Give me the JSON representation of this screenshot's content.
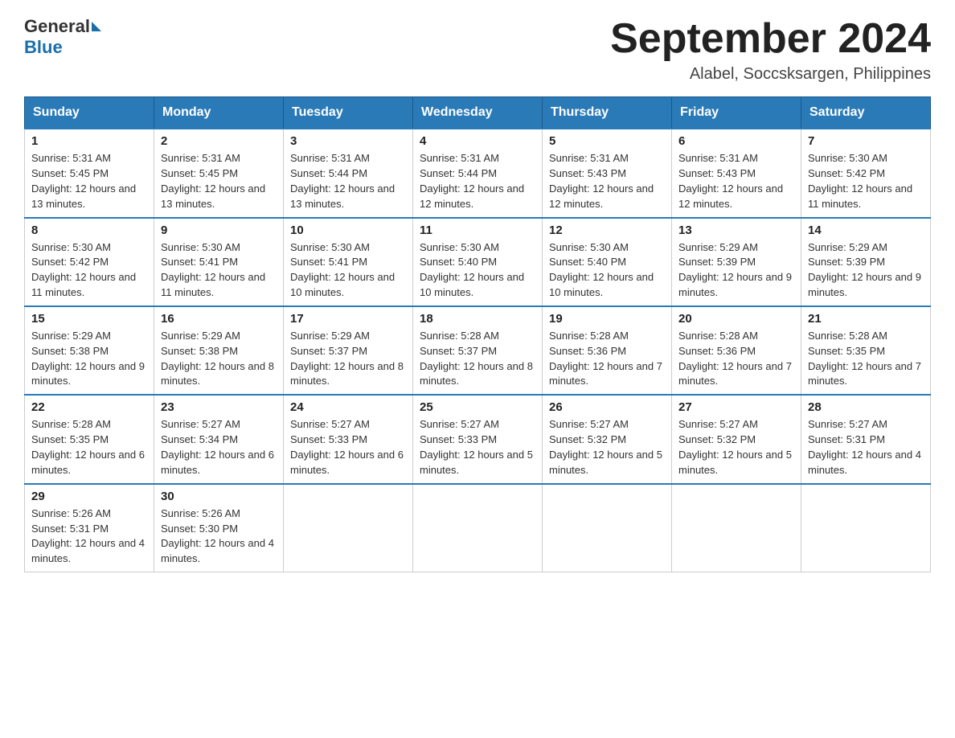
{
  "header": {
    "logo_general": "General",
    "logo_blue": "Blue",
    "month_title": "September 2024",
    "subtitle": "Alabel, Soccsksargen, Philippines"
  },
  "weekdays": [
    "Sunday",
    "Monday",
    "Tuesday",
    "Wednesday",
    "Thursday",
    "Friday",
    "Saturday"
  ],
  "weeks": [
    [
      {
        "day": "1",
        "sunrise": "5:31 AM",
        "sunset": "5:45 PM",
        "daylight": "12 hours and 13 minutes."
      },
      {
        "day": "2",
        "sunrise": "5:31 AM",
        "sunset": "5:45 PM",
        "daylight": "12 hours and 13 minutes."
      },
      {
        "day": "3",
        "sunrise": "5:31 AM",
        "sunset": "5:44 PM",
        "daylight": "12 hours and 13 minutes."
      },
      {
        "day": "4",
        "sunrise": "5:31 AM",
        "sunset": "5:44 PM",
        "daylight": "12 hours and 12 minutes."
      },
      {
        "day": "5",
        "sunrise": "5:31 AM",
        "sunset": "5:43 PM",
        "daylight": "12 hours and 12 minutes."
      },
      {
        "day": "6",
        "sunrise": "5:31 AM",
        "sunset": "5:43 PM",
        "daylight": "12 hours and 12 minutes."
      },
      {
        "day": "7",
        "sunrise": "5:30 AM",
        "sunset": "5:42 PM",
        "daylight": "12 hours and 11 minutes."
      }
    ],
    [
      {
        "day": "8",
        "sunrise": "5:30 AM",
        "sunset": "5:42 PM",
        "daylight": "12 hours and 11 minutes."
      },
      {
        "day": "9",
        "sunrise": "5:30 AM",
        "sunset": "5:41 PM",
        "daylight": "12 hours and 11 minutes."
      },
      {
        "day": "10",
        "sunrise": "5:30 AM",
        "sunset": "5:41 PM",
        "daylight": "12 hours and 10 minutes."
      },
      {
        "day": "11",
        "sunrise": "5:30 AM",
        "sunset": "5:40 PM",
        "daylight": "12 hours and 10 minutes."
      },
      {
        "day": "12",
        "sunrise": "5:30 AM",
        "sunset": "5:40 PM",
        "daylight": "12 hours and 10 minutes."
      },
      {
        "day": "13",
        "sunrise": "5:29 AM",
        "sunset": "5:39 PM",
        "daylight": "12 hours and 9 minutes."
      },
      {
        "day": "14",
        "sunrise": "5:29 AM",
        "sunset": "5:39 PM",
        "daylight": "12 hours and 9 minutes."
      }
    ],
    [
      {
        "day": "15",
        "sunrise": "5:29 AM",
        "sunset": "5:38 PM",
        "daylight": "12 hours and 9 minutes."
      },
      {
        "day": "16",
        "sunrise": "5:29 AM",
        "sunset": "5:38 PM",
        "daylight": "12 hours and 8 minutes."
      },
      {
        "day": "17",
        "sunrise": "5:29 AM",
        "sunset": "5:37 PM",
        "daylight": "12 hours and 8 minutes."
      },
      {
        "day": "18",
        "sunrise": "5:28 AM",
        "sunset": "5:37 PM",
        "daylight": "12 hours and 8 minutes."
      },
      {
        "day": "19",
        "sunrise": "5:28 AM",
        "sunset": "5:36 PM",
        "daylight": "12 hours and 7 minutes."
      },
      {
        "day": "20",
        "sunrise": "5:28 AM",
        "sunset": "5:36 PM",
        "daylight": "12 hours and 7 minutes."
      },
      {
        "day": "21",
        "sunrise": "5:28 AM",
        "sunset": "5:35 PM",
        "daylight": "12 hours and 7 minutes."
      }
    ],
    [
      {
        "day": "22",
        "sunrise": "5:28 AM",
        "sunset": "5:35 PM",
        "daylight": "12 hours and 6 minutes."
      },
      {
        "day": "23",
        "sunrise": "5:27 AM",
        "sunset": "5:34 PM",
        "daylight": "12 hours and 6 minutes."
      },
      {
        "day": "24",
        "sunrise": "5:27 AM",
        "sunset": "5:33 PM",
        "daylight": "12 hours and 6 minutes."
      },
      {
        "day": "25",
        "sunrise": "5:27 AM",
        "sunset": "5:33 PM",
        "daylight": "12 hours and 5 minutes."
      },
      {
        "day": "26",
        "sunrise": "5:27 AM",
        "sunset": "5:32 PM",
        "daylight": "12 hours and 5 minutes."
      },
      {
        "day": "27",
        "sunrise": "5:27 AM",
        "sunset": "5:32 PM",
        "daylight": "12 hours and 5 minutes."
      },
      {
        "day": "28",
        "sunrise": "5:27 AM",
        "sunset": "5:31 PM",
        "daylight": "12 hours and 4 minutes."
      }
    ],
    [
      {
        "day": "29",
        "sunrise": "5:26 AM",
        "sunset": "5:31 PM",
        "daylight": "12 hours and 4 minutes."
      },
      {
        "day": "30",
        "sunrise": "5:26 AM",
        "sunset": "5:30 PM",
        "daylight": "12 hours and 4 minutes."
      },
      null,
      null,
      null,
      null,
      null
    ]
  ]
}
